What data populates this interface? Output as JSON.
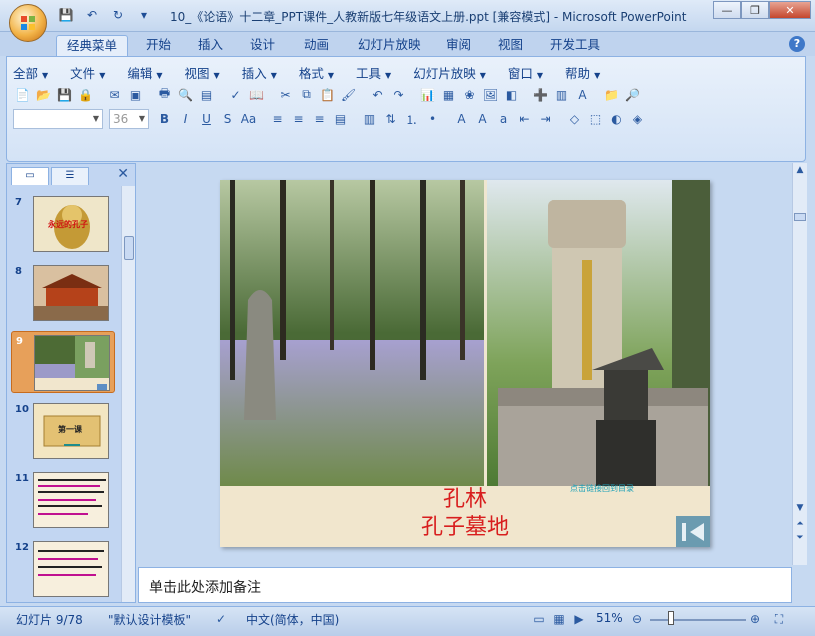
{
  "window": {
    "title": "10_《论语》十二章_PPT课件_人教新版七年级语文上册.ppt [兼容模式] - Microsoft PowerPoint",
    "qat_icons": [
      "save-icon",
      "undo-icon",
      "redo-icon",
      "customize-icon"
    ]
  },
  "ribbon_tabs": [
    "经典菜单",
    "开始",
    "插入",
    "设计",
    "动画",
    "幻灯片放映",
    "审阅",
    "视图",
    "开发工具"
  ],
  "active_tab": "经典菜单",
  "menubar": [
    "全部",
    "文件",
    "编辑",
    "视图",
    "插入",
    "格式",
    "工具",
    "幻灯片放映",
    "窗口",
    "帮助"
  ],
  "font": {
    "name": "",
    "size": "36"
  },
  "slides": [
    {
      "num": "7",
      "label": "永远的孔子"
    },
    {
      "num": "8",
      "label": ""
    },
    {
      "num": "9",
      "label": ""
    },
    {
      "num": "10",
      "label": "第一课"
    },
    {
      "num": "11",
      "label": ""
    },
    {
      "num": "12",
      "label": ""
    }
  ],
  "selected_slide": "9",
  "current_slide": {
    "caption_line1": "孔林",
    "caption_line2": "孔子墓地",
    "watermark": "点击链接回到目录"
  },
  "notes_placeholder": "单击此处添加备注",
  "status": {
    "slide_count": "幻灯片 9/78",
    "template": "\"默认设计模板\"",
    "language": "中文(简体，中国)",
    "zoom": "51%"
  },
  "colors": {
    "accent": "#15428b",
    "caption": "#d81e1e",
    "selected": "#e7a05a"
  }
}
